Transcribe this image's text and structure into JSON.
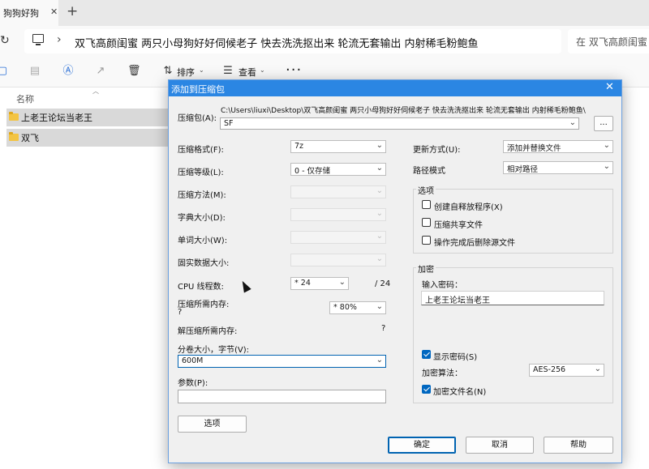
{
  "explorer": {
    "tab_title": "狗狗好狗",
    "breadcrumb": "双飞高颜闺蜜 两只小母狗好好伺候老子 快去洗洗抠出来 轮流无套输出 内射稀毛粉鲍鱼",
    "search_placeholder": "在 双飞高颜闺蜜",
    "toolbar": {
      "sort_label": "排序",
      "view_label": "查看"
    },
    "column_name": "名称",
    "files": [
      {
        "name": "上老王论坛当老王"
      },
      {
        "name": "双飞"
      }
    ]
  },
  "dialog": {
    "title": "添加到压缩包",
    "archive_label": "压缩包(A):",
    "archive_path": "C:\\Users\\liuxi\\Desktop\\双飞高颜闺蜜 两只小母狗好好伺候老子 快去洗洗抠出来 轮流无套输出 内射稀毛粉鲍鱼\\",
    "archive_name": "SF",
    "browse_label": "...",
    "format_label": "压缩格式(F):",
    "format_value": "7z",
    "level_label": "压缩等级(L):",
    "level_value": "0 - 仅存储",
    "method_label": "压缩方法(M):",
    "dict_label": "字典大小(D):",
    "word_label": "单词大小(W):",
    "solid_label": "固实数据大小:",
    "cpu_label": "CPU 线程数:",
    "cpu_value": "* 24",
    "cpu_total": "/ 24",
    "mem_label": "压缩所需内存:",
    "mem_value": "?",
    "mem_pct": "* 80%",
    "decomp_label": "解压缩所需内存:",
    "decomp_value": "?",
    "split_label": "分卷大小，字节(V):",
    "split_value": "600M",
    "params_label": "参数(P):",
    "options_button": "选项",
    "update_label": "更新方式(U):",
    "update_value": "添加并替换文件",
    "path_label": "路径模式",
    "path_value": "相对路径",
    "options_group": "选项",
    "opt_sfx": "创建自释放程序(X)",
    "opt_shared": "压缩共享文件",
    "opt_delete": "操作完成后删除源文件",
    "encrypt_group": "加密",
    "password_label": "输入密码：",
    "password_value": "上老王论坛当老王",
    "show_password": "显示密码(S)",
    "enc_method_label": "加密算法：",
    "enc_method_value": "AES-256",
    "encrypt_names": "加密文件名(N)",
    "ok": "确定",
    "cancel": "取消",
    "help": "帮助"
  }
}
